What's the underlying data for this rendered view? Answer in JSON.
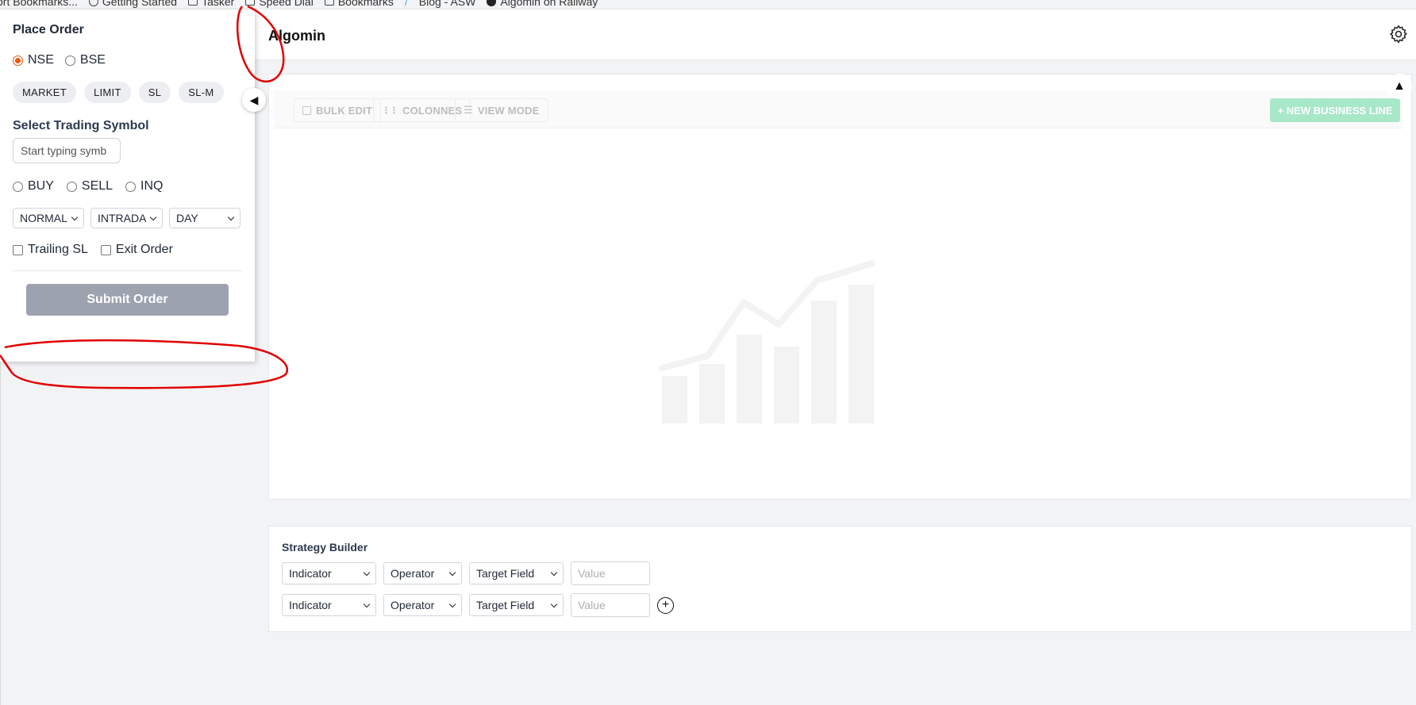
{
  "bookmarks": [
    "ort Bookmarks...",
    "Getting Started",
    "Tasker",
    "Speed Dial",
    "Bookmarks",
    "/",
    "Blog - ASW",
    "Algomin on Railway"
  ],
  "order_panel": {
    "title": "Place Order",
    "exchanges": [
      {
        "label": "NSE",
        "checked": true
      },
      {
        "label": "BSE",
        "checked": false
      }
    ],
    "order_types": [
      "MARKET",
      "LIMIT",
      "SL",
      "SL-M"
    ],
    "symbol_label": "Select Trading Symbol",
    "symbol_placeholder": "Start typing symb",
    "sides": [
      "BUY",
      "SELL",
      "INQ"
    ],
    "selects": [
      "NORMAL",
      "INTRADAY",
      "DAY"
    ],
    "checkboxes": [
      "Trailing SL",
      "Exit Order"
    ],
    "submit_label": "Submit Order"
  },
  "header": {
    "title": "Algomin"
  },
  "toolbar": {
    "bulk_edit": "BULK EDIT",
    "colonnes": "COLONNES",
    "view_mode": "VIEW MODE",
    "new_business_line": "+ NEW BUSINESS LINE"
  },
  "strategy": {
    "title": "Strategy Builder",
    "rows": [
      {
        "indicator": "Indicator",
        "operator": "Operator",
        "target": "Target Field",
        "value_placeholder": "Value"
      },
      {
        "indicator": "Indicator",
        "operator": "Operator",
        "target": "Target Field",
        "value_placeholder": "Value"
      }
    ]
  },
  "colors": {
    "accent_radio": "#ea580c",
    "submit_bg": "#9ca3af",
    "new_bl_bg": "#a7e8c8",
    "annotation": "#e00000"
  }
}
